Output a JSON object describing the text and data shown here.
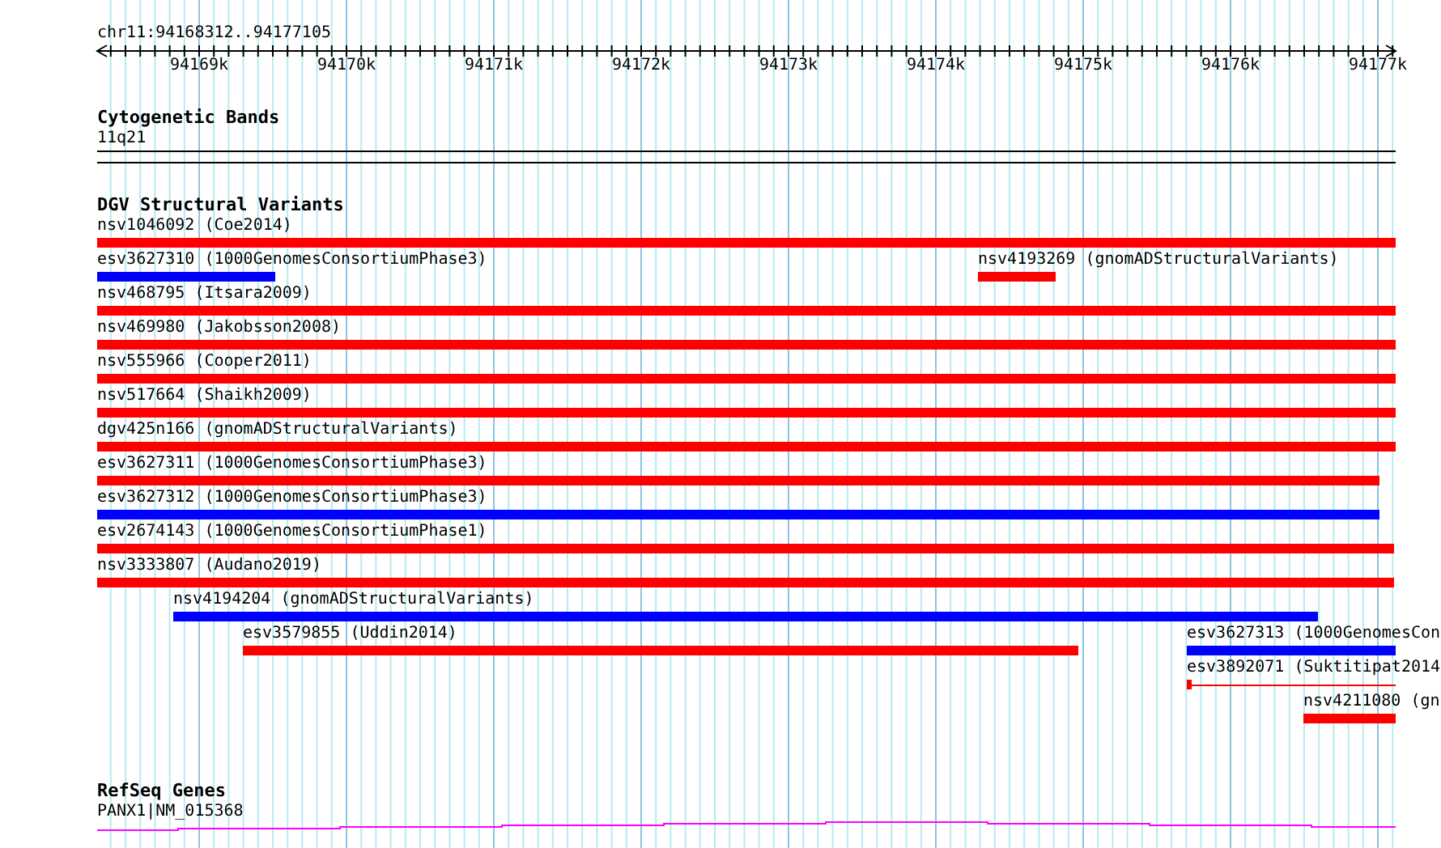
{
  "location": "chr11:94168312..94177105",
  "ruler_ticks": [
    "94169k",
    "94170k",
    "94171k",
    "94172k",
    "94173k",
    "94174k",
    "94175k",
    "94176k",
    "94177k"
  ],
  "cytogenetic_bands": {
    "title": "Cytogenetic Bands",
    "band": "11q21"
  },
  "structural_variants": {
    "title": "DGV Structural Variants",
    "features": [
      {
        "label": "nsv1046092 (Coe2014)",
        "color": "#ff0000",
        "kind": "bar"
      },
      {
        "label": "esv3627310 (1000GenomesConsortiumPhase3)",
        "color": "#0000ff",
        "kind": "bar"
      },
      {
        "label": "nsv4193269 (gnomADStructuralVariants)",
        "color": "#ff0000",
        "kind": "bar"
      },
      {
        "label": "nsv468795 (Itsara2009)",
        "color": "#ff0000",
        "kind": "bar"
      },
      {
        "label": "nsv469980 (Jakobsson2008)",
        "color": "#ff0000",
        "kind": "bar"
      },
      {
        "label": "nsv555966 (Cooper2011)",
        "color": "#ff0000",
        "kind": "bar"
      },
      {
        "label": "nsv517664 (Shaikh2009)",
        "color": "#ff0000",
        "kind": "bar"
      },
      {
        "label": "dgv425n166 (gnomADStructuralVariants)",
        "color": "#ff0000",
        "kind": "bar"
      },
      {
        "label": "esv3627311 (1000GenomesConsortiumPhase3)",
        "color": "#ff0000",
        "kind": "bar"
      },
      {
        "label": "esv3627312 (1000GenomesConsortiumPhase3)",
        "color": "#0000ff",
        "kind": "bar"
      },
      {
        "label": "esv2674143 (1000GenomesConsortiumPhase1)",
        "color": "#ff0000",
        "kind": "bar"
      },
      {
        "label": "nsv3333807 (Audano2019)",
        "color": "#ff0000",
        "kind": "bar"
      },
      {
        "label": "nsv4194204 (gnomADStructuralVariants)",
        "color": "#0000ff",
        "kind": "bar"
      },
      {
        "label": "esv3579855 (Uddin2014)",
        "color": "#ff0000",
        "kind": "bar"
      },
      {
        "label": "esv3627313 (1000GenomesCon",
        "color": "#0000ff",
        "kind": "bar"
      },
      {
        "label": "esv3892071 (Suktitipat2014",
        "color": "#ff0000",
        "kind": "line"
      },
      {
        "label": "nsv4211080 (gn",
        "color": "#ff0000",
        "kind": "bar"
      }
    ]
  },
  "refseq_genes": {
    "title": "RefSeq Genes",
    "gene": "PANX1|NM_015368"
  }
}
